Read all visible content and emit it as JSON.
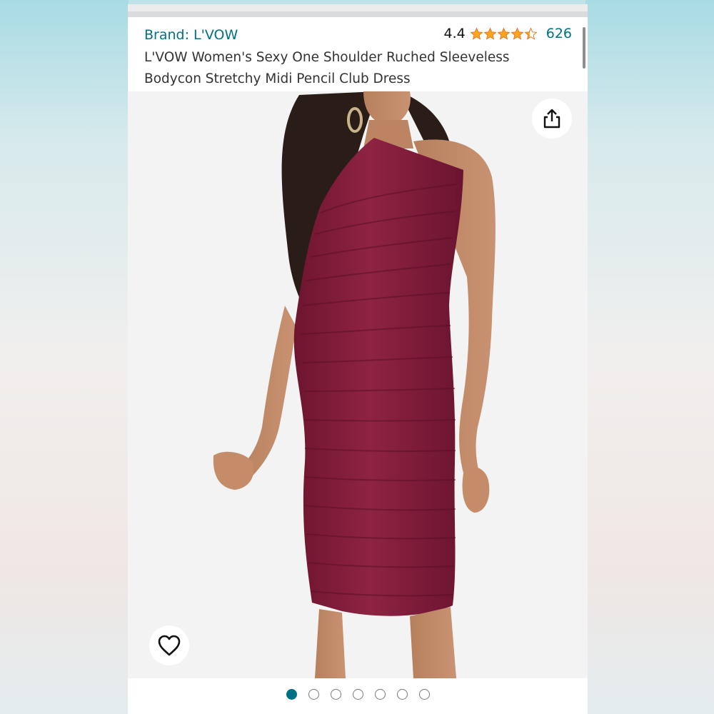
{
  "product": {
    "brand_label": "Brand: L'VOW",
    "rating_value": "4.4",
    "rating_stars": 4.4,
    "review_count": "626",
    "title": "L'VOW Women's Sexy One Shoulder Ruched Sleeveless Bodycon Stretchy Midi Pencil Club Dress"
  },
  "image": {
    "subject": "woman-in-burgundy-one-shoulder-dress",
    "dress_color": "#8a1e3c",
    "background_color": "#f3f3f3"
  },
  "icons": {
    "share": "share-icon",
    "wishlist": "heart-icon"
  },
  "carousel": {
    "total": 7,
    "active_index": 0
  },
  "colors": {
    "link": "#007185",
    "star": "#ffa41c",
    "text": "#333333"
  }
}
